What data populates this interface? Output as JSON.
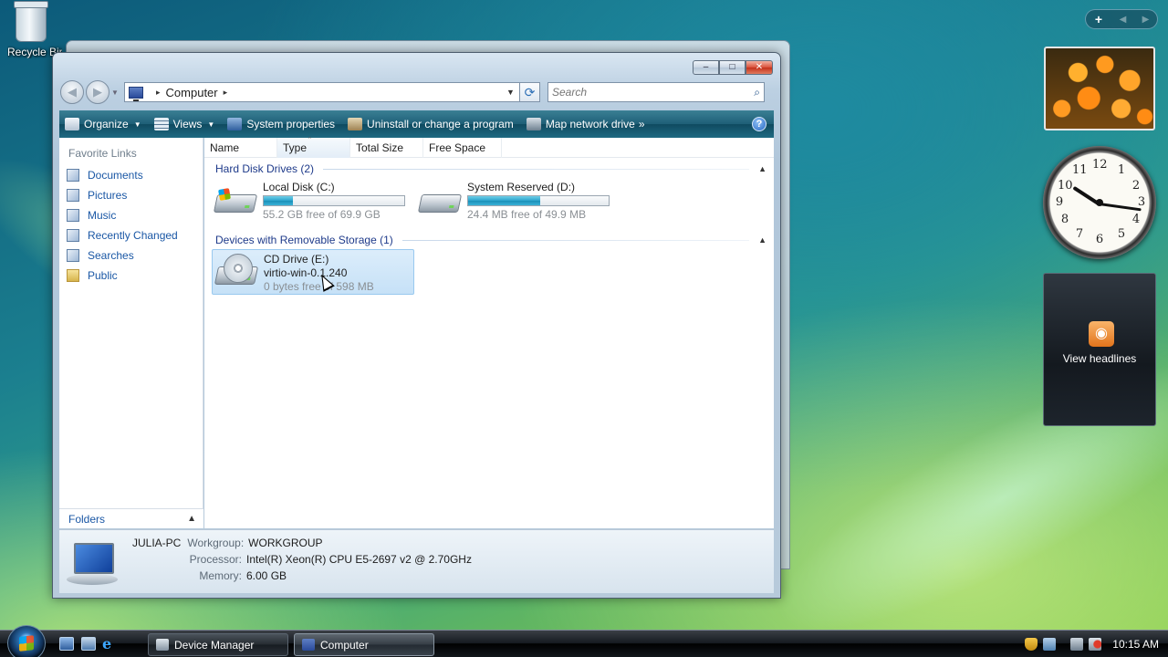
{
  "desktop": {
    "recycle_bin_label": "Recycle Bin"
  },
  "window": {
    "title": "Computer",
    "controls": {
      "minimize": "–",
      "maximize": "□",
      "close": "✕"
    },
    "address": {
      "root_arrow": "▸",
      "location": "Computer",
      "trail_arrow": "▸"
    },
    "search_placeholder": "Search",
    "toolbar": {
      "organize": "Organize",
      "views": "Views",
      "system_properties": "System properties",
      "uninstall": "Uninstall or change a program",
      "map_drive": "Map network drive",
      "more": "»",
      "help": "?"
    },
    "favorite_links_title": "Favorite Links",
    "favorites": [
      {
        "label": "Documents",
        "icon": "documents-icon"
      },
      {
        "label": "Pictures",
        "icon": "pictures-icon"
      },
      {
        "label": "Music",
        "icon": "music-icon"
      },
      {
        "label": "Recently Changed",
        "icon": "recently-changed-icon"
      },
      {
        "label": "Searches",
        "icon": "searches-icon"
      },
      {
        "label": "Public",
        "icon": "folder-icon"
      }
    ],
    "folders_label": "Folders",
    "columns": [
      "Name",
      "Type",
      "Total Size",
      "Free Space"
    ],
    "groups": {
      "hdd_title": "Hard Disk Drives (2)",
      "removable_title": "Devices with Removable Storage (1)"
    },
    "drives": [
      {
        "name": "Local Disk (C:)",
        "free_text": "55.2 GB free of 69.9 GB",
        "used_fraction": 0.21
      },
      {
        "name": "System Reserved (D:)",
        "free_text": "24.4 MB free of 49.9 MB",
        "used_fraction": 0.51
      }
    ],
    "cd_drive": {
      "name": "CD Drive (E:)",
      "label": "virtio-win-0.1.240",
      "free_text": "0 bytes free of 598 MB"
    },
    "details": {
      "pc_name": "JULIA-PC",
      "workgroup_label": "Workgroup:",
      "workgroup_value": "WORKGROUP",
      "processor_label": "Processor:",
      "processor_value": "Intel(R) Xeon(R) CPU E5-2697 v2 @ 2.70GHz",
      "memory_label": "Memory:",
      "memory_value": "6.00 GB"
    }
  },
  "gadgets": {
    "add": "+",
    "clock_numbers": [
      "12",
      "1",
      "2",
      "3",
      "4",
      "5",
      "6",
      "7",
      "8",
      "9",
      "10",
      "11"
    ],
    "feed_text": "View headlines"
  },
  "taskbar": {
    "tasks": [
      {
        "label": "Device Manager"
      },
      {
        "label": "Computer"
      }
    ],
    "time": "10:15 AM"
  }
}
